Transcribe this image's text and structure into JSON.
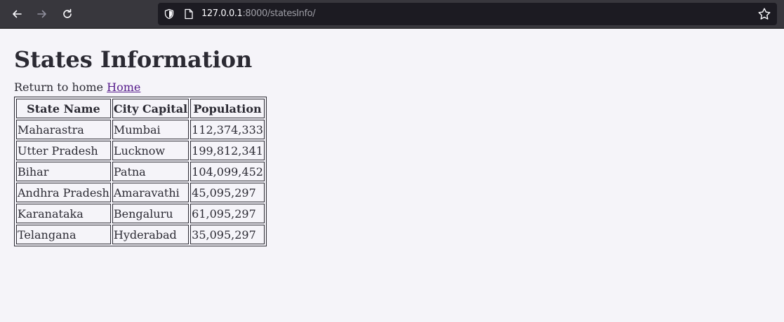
{
  "browser": {
    "url_host": "127.0.0.1",
    "url_rest": ":8000/statesInfo/"
  },
  "page": {
    "title": "States Information",
    "home_prefix": "Return to home",
    "home_link": "Home"
  },
  "table": {
    "headers": [
      "State Name",
      "City Capital",
      "Population"
    ],
    "rows": [
      [
        "Maharastra",
        "Mumbai",
        "112,374,333"
      ],
      [
        "Utter Pradesh",
        "Lucknow",
        "199,812,341"
      ],
      [
        "Bihar",
        "Patna",
        "104,099,452"
      ],
      [
        "Andhra Pradesh",
        "Amaravathi",
        "45,095,297"
      ],
      [
        "Karanataka",
        "Bengaluru",
        "61,095,297"
      ],
      [
        "Telangana",
        "Hyderabad",
        "35,095,297"
      ]
    ]
  },
  "icons": {
    "back": "arrow-left-icon",
    "forward": "arrow-right-icon",
    "reload": "reload-icon",
    "shield": "shield-icon",
    "page": "page-icon",
    "bookmark": "star-icon"
  }
}
